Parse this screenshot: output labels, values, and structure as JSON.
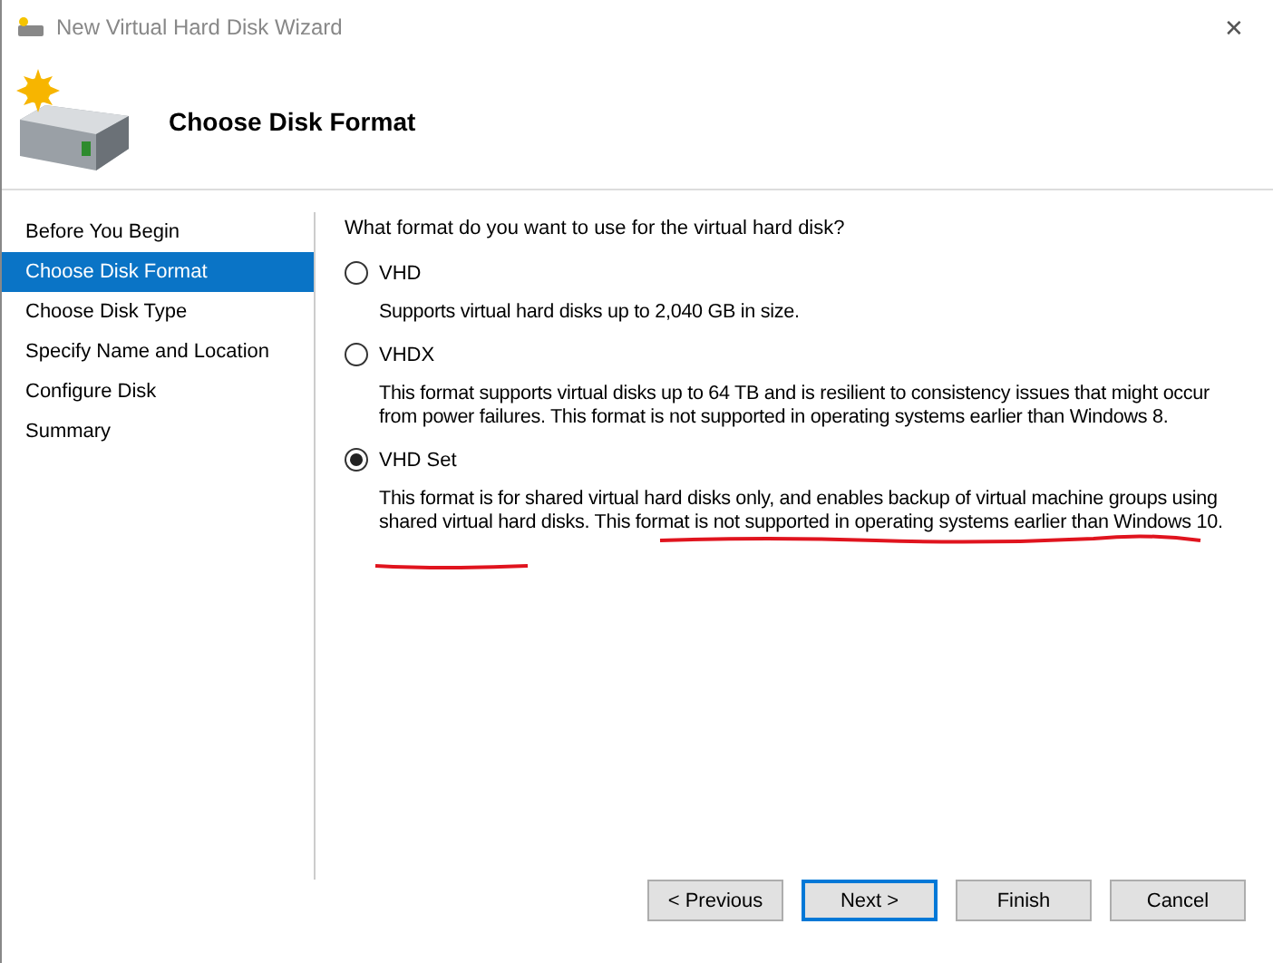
{
  "window": {
    "title": "New Virtual Hard Disk Wizard",
    "close": "✕"
  },
  "header": {
    "title": "Choose Disk Format"
  },
  "sidebar": {
    "items": [
      {
        "label": "Before You Begin",
        "selected": false
      },
      {
        "label": "Choose Disk Format",
        "selected": true
      },
      {
        "label": "Choose Disk Type",
        "selected": false
      },
      {
        "label": "Specify Name and Location",
        "selected": false
      },
      {
        "label": "Configure Disk",
        "selected": false
      },
      {
        "label": "Summary",
        "selected": false
      }
    ]
  },
  "question": "What format do you want to use for the virtual hard disk?",
  "options": [
    {
      "label": "VHD",
      "selected": false,
      "description": "Supports virtual hard disks up to 2,040 GB in size."
    },
    {
      "label": "VHDX",
      "selected": false,
      "description": "This format supports virtual disks up to 64 TB and is resilient to consistency issues that might occur from power failures. This format is not supported in operating systems earlier than Windows 8."
    },
    {
      "label": "VHD Set",
      "selected": true,
      "description": "This format is for shared virtual hard disks only, and enables backup of virtual machine groups using shared virtual hard disks. This format is not supported in operating systems earlier than Windows 10.",
      "annotated": true
    }
  ],
  "buttons": [
    {
      "label": "< Previous",
      "focused": false
    },
    {
      "label": "Next >",
      "focused": true
    },
    {
      "label": "Finish",
      "focused": false
    },
    {
      "label": "Cancel",
      "focused": false
    }
  ]
}
